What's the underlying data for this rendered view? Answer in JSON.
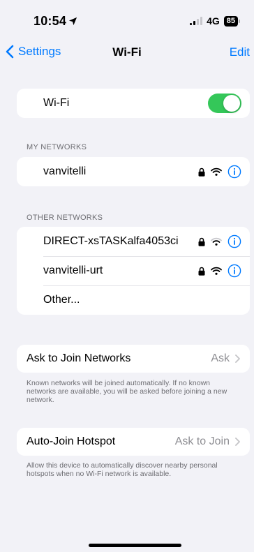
{
  "status_bar": {
    "time": "10:54",
    "network_type": "4G",
    "battery_level": "85",
    "signal_bars_active": 2,
    "signal_bars_total": 4
  },
  "nav": {
    "back_label": "Settings",
    "title": "Wi-Fi",
    "edit_label": "Edit"
  },
  "wifi_toggle": {
    "label": "Wi-Fi",
    "on": true,
    "color": "#34c759"
  },
  "my_networks": {
    "header": "MY NETWORKS",
    "items": [
      {
        "name": "vanvitelli",
        "locked": true,
        "signal": "full"
      }
    ]
  },
  "other_networks": {
    "header": "OTHER NETWORKS",
    "items": [
      {
        "name": "DIRECT-xsTASKalfa4053ci",
        "locked": true,
        "signal": "medium"
      },
      {
        "name": "vanvitelli-urt",
        "locked": true,
        "signal": "full"
      }
    ],
    "other_label": "Other..."
  },
  "ask_to_join": {
    "label": "Ask to Join Networks",
    "value": "Ask",
    "footer": "Known networks will be joined automatically. If no known networks are available, you will be asked before joining a new network."
  },
  "auto_join": {
    "label": "Auto-Join Hotspot",
    "value": "Ask to Join",
    "footer": "Allow this device to automatically discover nearby personal hotspots when no Wi-Fi network is available."
  },
  "colors": {
    "accent": "#007aff",
    "background": "#f2f2f7",
    "secondary_text": "#8e8e93"
  }
}
